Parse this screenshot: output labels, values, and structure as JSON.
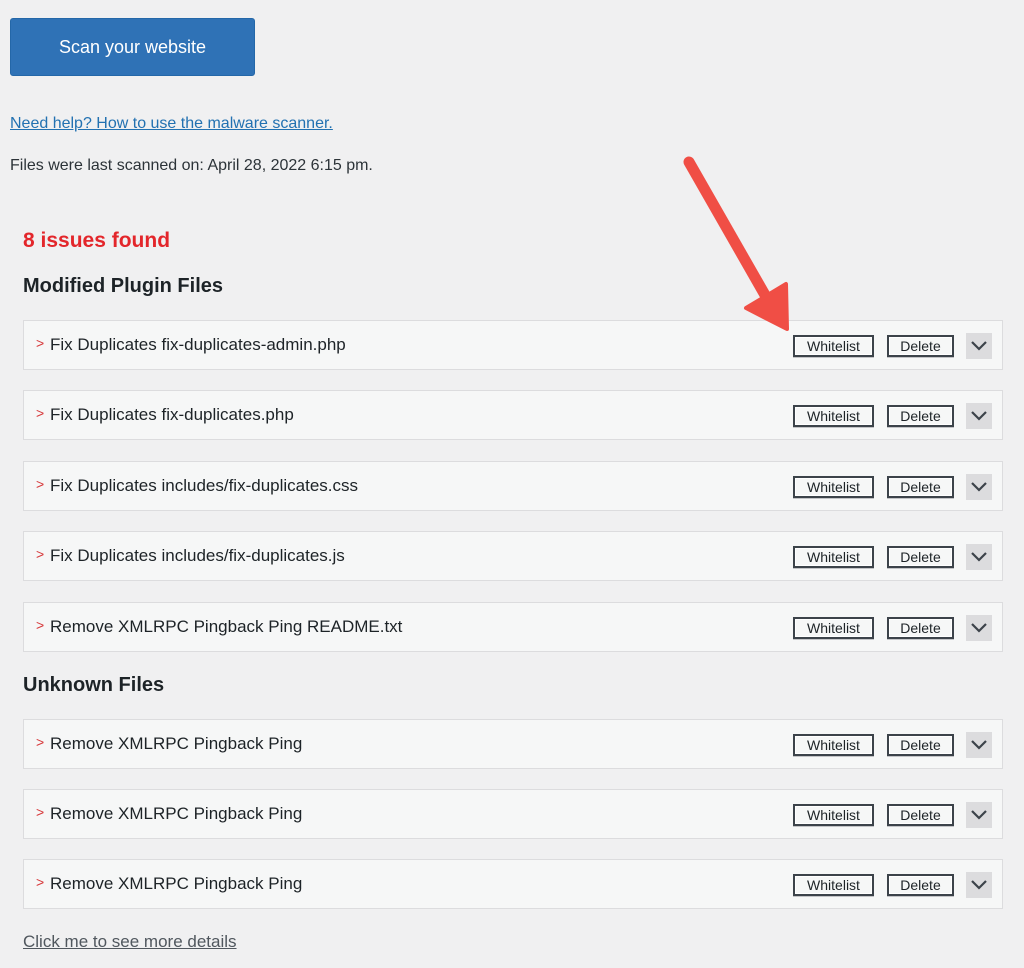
{
  "scan_button": {
    "label": "Scan your website"
  },
  "help_link": {
    "label": "Need help? How to use the malware scanner."
  },
  "last_scanned": {
    "text": "Files were last scanned on: April 28, 2022 6:15 pm."
  },
  "issues": {
    "summary": "8 issues found"
  },
  "sections": [
    {
      "title": "Modified Plugin Files",
      "rows": [
        {
          "caret": ">",
          "label": "Fix Duplicates fix-duplicates-admin.php",
          "whitelist": "Whitelist",
          "delete": "Delete"
        },
        {
          "caret": ">",
          "label": "Fix Duplicates fix-duplicates.php",
          "whitelist": "Whitelist",
          "delete": "Delete"
        },
        {
          "caret": ">",
          "label": "Fix Duplicates includes/fix-duplicates.css",
          "whitelist": "Whitelist",
          "delete": "Delete"
        },
        {
          "caret": ">",
          "label": "Fix Duplicates includes/fix-duplicates.js",
          "whitelist": "Whitelist",
          "delete": "Delete"
        },
        {
          "caret": ">",
          "label": "Remove XMLRPC Pingback Ping README.txt",
          "whitelist": "Whitelist",
          "delete": "Delete"
        }
      ]
    },
    {
      "title": "Unknown Files",
      "rows": [
        {
          "caret": ">",
          "label": "Remove XMLRPC Pingback Ping",
          "whitelist": "Whitelist",
          "delete": "Delete"
        },
        {
          "caret": ">",
          "label": "Remove XMLRPC Pingback Ping",
          "whitelist": "Whitelist",
          "delete": "Delete"
        },
        {
          "caret": ">",
          "label": "Remove XMLRPC Pingback Ping",
          "whitelist": "Whitelist",
          "delete": "Delete"
        }
      ]
    }
  ],
  "more_details": {
    "label": "Click me to see more details"
  },
  "colors": {
    "primary_button": "#2f72b6",
    "issues_red": "#e3262b",
    "annotation_arrow": "#f04e45",
    "link_blue": "#2271b1"
  },
  "icons": {
    "row_expand": "chevron-down-icon",
    "annotation": "arrow-annotation"
  }
}
